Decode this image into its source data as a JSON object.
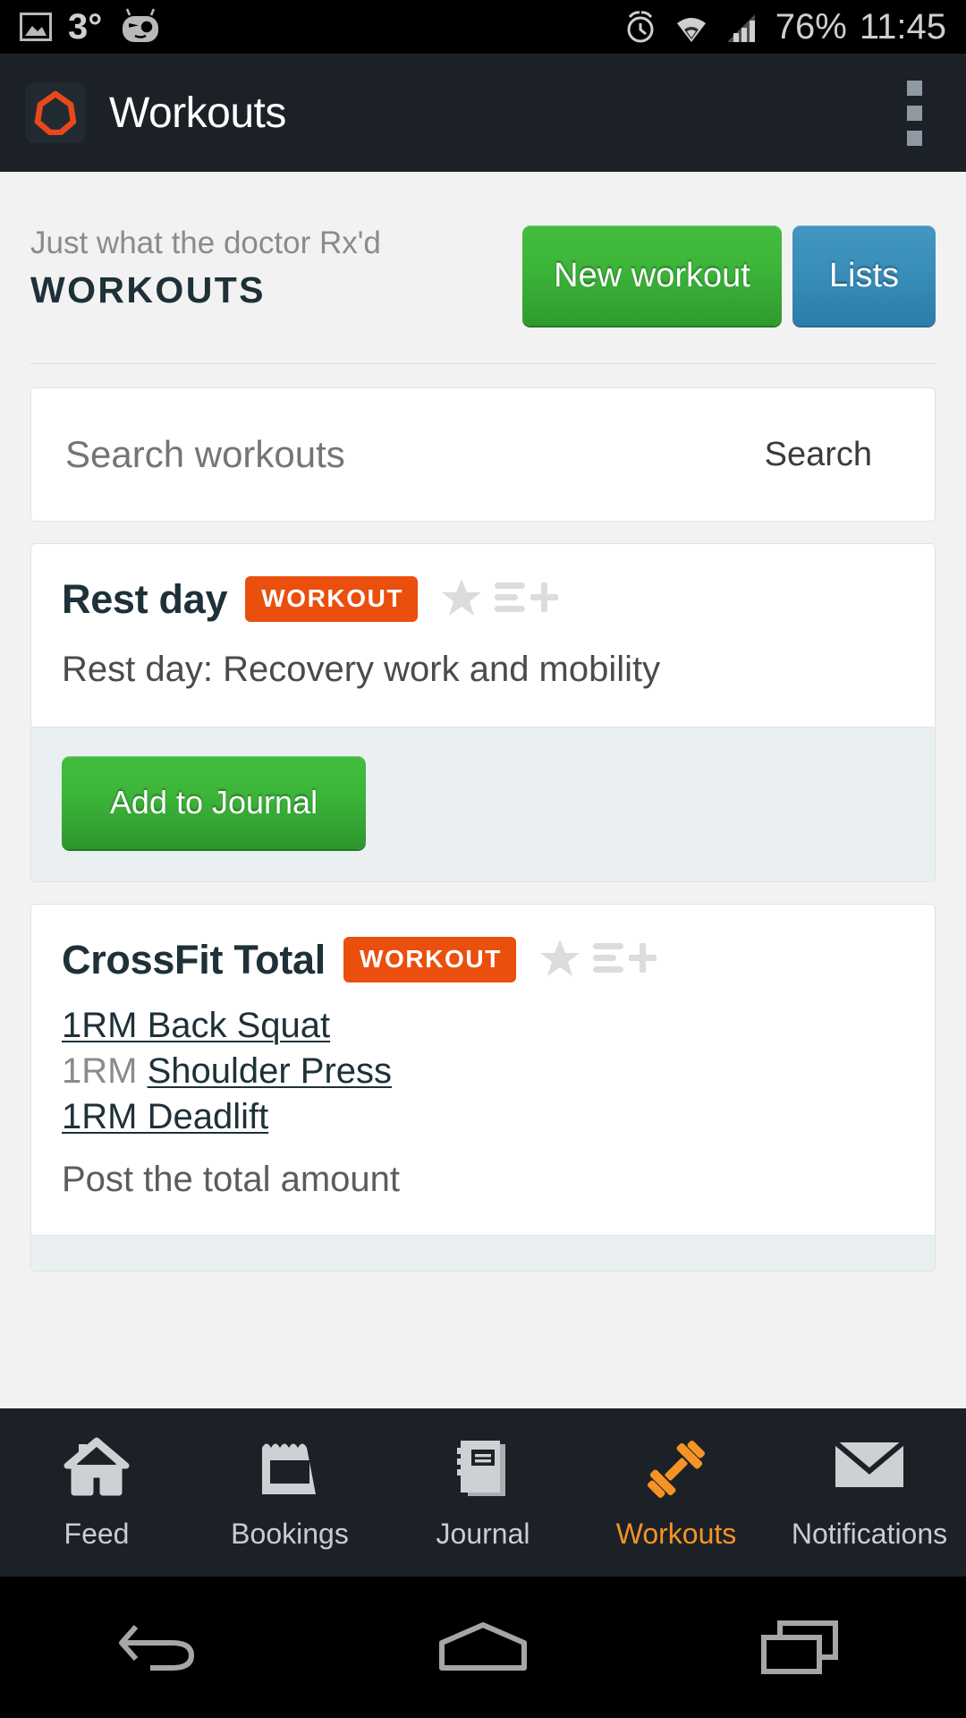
{
  "status_bar": {
    "image_icon": "image-icon",
    "temperature": "3°",
    "cyanogen_icon": "cyanogenmod-robot-icon",
    "alarm_icon": "alarm-clock-icon",
    "wifi_icon": "wifi-icon",
    "signal_icon": "cellular-signal-icon",
    "battery": "76%",
    "clock": "11:45"
  },
  "header": {
    "logo_icon": "app-logo-heptagon-icon",
    "title": "Workouts",
    "overflow_icon": "overflow-menu-icon"
  },
  "page": {
    "kicker": "Just what the doctor Rx'd",
    "title": "WORKOUTS",
    "new_workout_label": "New workout",
    "lists_label": "Lists"
  },
  "search": {
    "placeholder": "Search workouts",
    "value": "",
    "button_label": "Search"
  },
  "workouts": [
    {
      "title": "Rest day",
      "badge": "WORKOUT",
      "star_icon": "star-icon",
      "playlist_add_icon": "playlist-add-icon",
      "description": "Rest day: Recovery work and mobility",
      "footer_button": "Add to Journal"
    },
    {
      "title": "CrossFit Total",
      "badge": "WORKOUT",
      "star_icon": "star-icon",
      "playlist_add_icon": "playlist-add-icon",
      "lines": [
        {
          "link": "1RM Back Squat",
          "prefix": ""
        },
        {
          "link": "Shoulder Press",
          "prefix": "1RM "
        },
        {
          "link": "1RM Deadlift",
          "prefix": ""
        }
      ],
      "note": "Post the total amount"
    }
  ],
  "tabs": [
    {
      "label": "Feed",
      "icon": "home-icon",
      "active": false
    },
    {
      "label": "Bookings",
      "icon": "calendar-icon",
      "active": false
    },
    {
      "label": "Journal",
      "icon": "notebook-icon",
      "active": false
    },
    {
      "label": "Workouts",
      "icon": "dumbbell-icon",
      "active": true
    },
    {
      "label": "Notifications",
      "icon": "envelope-icon",
      "active": false
    }
  ],
  "nav_bar": {
    "back_icon": "back-arrow-icon",
    "home_icon": "home-pentagon-icon",
    "recents_icon": "recent-apps-icon"
  },
  "colors": {
    "accent_orange": "#ea4f0d",
    "tab_active_orange": "#f59324",
    "brand_dark": "#1b2127",
    "green_button": "#3cb539",
    "blue_button": "#3a8fba",
    "title_navy": "#1e3038"
  }
}
